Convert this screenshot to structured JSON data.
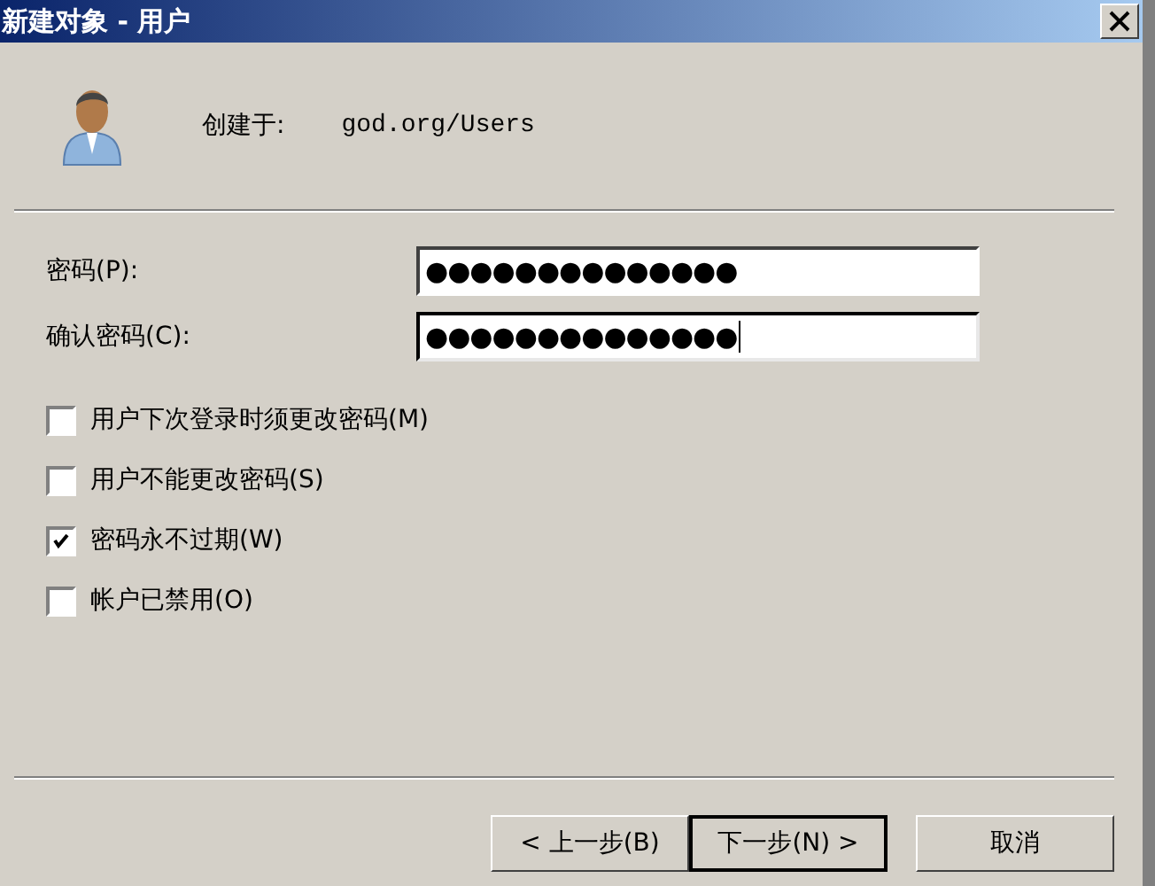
{
  "window": {
    "title": "新建对象 - 用户"
  },
  "created_in": {
    "label": "创建于:",
    "value": "god.org/Users"
  },
  "fields": [
    {
      "label": "密码(P):",
      "value": "●●●●●●●●●●●●●●",
      "focused": false
    },
    {
      "label": "确认密码(C):",
      "value": "●●●●●●●●●●●●●●",
      "focused": true
    }
  ],
  "options": [
    {
      "label": "用户下次登录时须更改密码(M)",
      "checked": false
    },
    {
      "label": "用户不能更改密码(S)",
      "checked": false
    },
    {
      "label": "密码永不过期(W)",
      "checked": true
    },
    {
      "label": "帐户已禁用(O)",
      "checked": false
    }
  ],
  "buttons": [
    {
      "label": "< 上一步(B)",
      "default": false
    },
    {
      "label": "下一步(N) >",
      "default": true
    },
    {
      "label": "取消",
      "default": false
    }
  ]
}
